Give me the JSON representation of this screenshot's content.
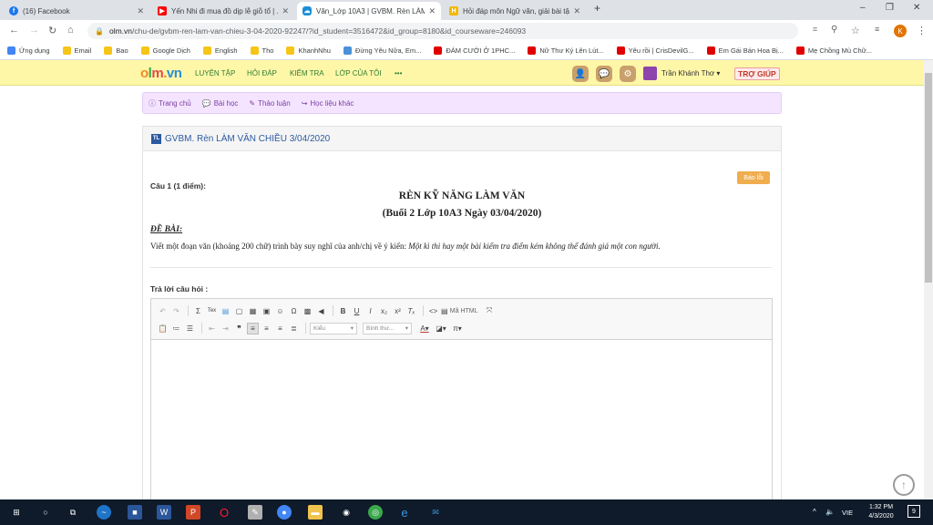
{
  "browser": {
    "tabs": [
      {
        "label": "(16) Facebook",
        "icon": "facebook-icon",
        "color": "#1877f2"
      },
      {
        "label": "Yến Nhi đi mua đồ dịp lễ giỗ tổ | ...",
        "icon": "youtube-icon",
        "color": "#ff0000"
      },
      {
        "label": "Văn_Lớp 10A3 | GVBM. Rèn LÀM ...",
        "icon": "olm-icon",
        "color": "#1a8fd6",
        "active": true
      },
      {
        "label": "Hỏi đáp môn Ngữ văn, giải bài tậ...",
        "icon": "hoc24-icon",
        "color": "#f5b800"
      }
    ],
    "new_tab": "+",
    "window": {
      "minimize": "–",
      "restore": "❐",
      "close": "✕"
    },
    "url_host": "olm.vn",
    "url_path": "/chu-de/gvbm-ren-lam-van-chieu-3-04-2020-92247/?id_student=3516472&id_group=8180&id_courseware=246093",
    "profile_initial": "K",
    "bookmarks": [
      {
        "label": "Ứng dụng",
        "color": "#4285f4"
      },
      {
        "label": "Email",
        "color": "#f5c518"
      },
      {
        "label": "Bao",
        "color": "#f5c518"
      },
      {
        "label": "Google Dịch",
        "color": "#f5c518"
      },
      {
        "label": "English",
        "color": "#f5c518"
      },
      {
        "label": "Tho",
        "color": "#f5c518"
      },
      {
        "label": "KhanhNhu",
        "color": "#f5c518"
      },
      {
        "label": "Đừng Yêu Nữa, Em...",
        "color": "#4a90d9"
      },
      {
        "label": "ĐÁM CƯỚI Ở 1PHC...",
        "color": "#e00000"
      },
      {
        "label": "Nữ Thư Ký Lên Lút...",
        "color": "#e00000"
      },
      {
        "label": "Yêu rồi | CrisDevilG...",
        "color": "#e00000"
      },
      {
        "label": "Em Gái Bán Hoa Bị...",
        "color": "#e00000"
      },
      {
        "label": "Mẹ Chồng Mù Chữ...",
        "color": "#e00000"
      }
    ]
  },
  "site": {
    "logo": "olm.vn",
    "menu": [
      "LUYỆN TẬP",
      "HỎI ĐÁP",
      "KIỂM TRA",
      "LỚP CỦA TÔI",
      "•••"
    ],
    "user_name": "Trần Khánh Thơ",
    "help": "TRỢ GIÚP",
    "subnav": [
      {
        "icon": "ⓘ",
        "label": "Trang chủ"
      },
      {
        "icon": "💬",
        "label": "Bài học"
      },
      {
        "icon": "✎",
        "label": "Thảo luận"
      },
      {
        "icon": "↪",
        "label": "Học liệu khác"
      }
    ]
  },
  "card": {
    "chip": "TL",
    "title": "GVBM. Rèn LÀM VĂN CHIỀU 3/04/2020",
    "report_button": "Báo lỗi",
    "question_label": "Câu 1 (1 điểm):",
    "heading1": "RÈN KỸ NĂNG LÀM VĂN",
    "heading2": "(Buổi 2  Lớp 10A3  Ngày 03/04/2020)",
    "de_bai": "ĐỀ BÀI:",
    "prompt": "Viết một đoạn văn (khoảng 200 chữ) trình bày suy nghĩ của anh/chị về ý kiến: ",
    "prompt_quote": "Một kì thi hay một bài kiểm tra điểm kém không thể đánh giá một con người.",
    "answer_label": "Trả lời câu hỏi :"
  },
  "editor": {
    "source_label": "Mã HTML",
    "format_combo": "Kiểu",
    "style_combo": "Bình thư..."
  },
  "taskbar": {
    "lang": "VIE",
    "time": "1:32 PM",
    "date": "4/3/2020",
    "notif_count": "9"
  }
}
